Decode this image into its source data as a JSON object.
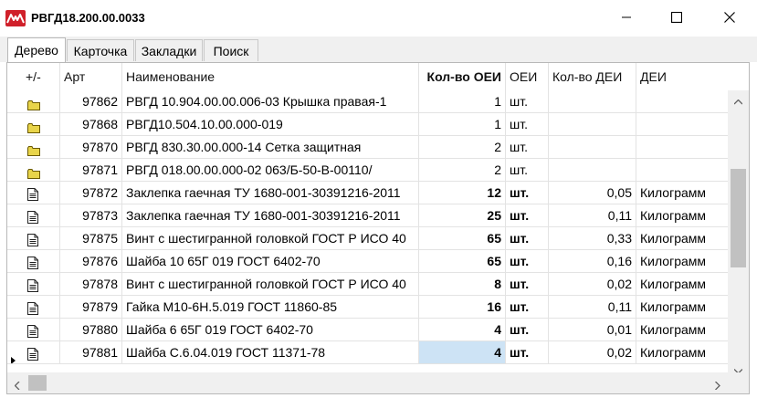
{
  "window": {
    "title": "РВГД18.200.00.0033",
    "minimize_icon": "minimize-icon",
    "maximize_icon": "maximize-icon",
    "close_icon": "close-icon"
  },
  "tabs": [
    {
      "label": "Дерево",
      "active": true
    },
    {
      "label": "Карточка",
      "active": false
    },
    {
      "label": "Закладки",
      "active": false
    },
    {
      "label": "Поиск",
      "active": false
    }
  ],
  "grid": {
    "columns": {
      "expand": "+/-",
      "art": "Арт",
      "name": "Наименование",
      "qty_oei": "Кол-во ОЕИ",
      "oei": "ОЕИ",
      "qty_dei": "Кол-во ДЕИ",
      "dei": "ДЕИ"
    },
    "rows": [
      {
        "icon": "folder-icon",
        "art": "97862",
        "name": "РВГД 10.904.00.00.006-03 Крышка правая-1",
        "qty_oei": "1",
        "oei": "шт.",
        "qty_dei": "",
        "dei": "",
        "bold": false
      },
      {
        "icon": "folder-icon",
        "art": "97868",
        "name": "РВГД10.504.10.00.000-019",
        "qty_oei": "1",
        "oei": "шт.",
        "qty_dei": "",
        "dei": "",
        "bold": false
      },
      {
        "icon": "folder-icon",
        "art": "97870",
        "name": "РВГД 830.30.00.000-14 Сетка защитная",
        "qty_oei": "2",
        "oei": "шт.",
        "qty_dei": "",
        "dei": "",
        "bold": false
      },
      {
        "icon": "folder-icon",
        "art": "97871",
        "name": "РВГД 018.00.00.000-02 063/Б-50-В-00110/",
        "qty_oei": "2",
        "oei": "шт.",
        "qty_dei": "",
        "dei": "",
        "bold": false
      },
      {
        "icon": "document-icon",
        "art": "97872",
        "name": "Заклепка гаечная ТУ 1680-001-30391216-2011",
        "qty_oei": "12",
        "oei": "шт.",
        "qty_dei": "0,05",
        "dei": "Килограмм",
        "bold": true
      },
      {
        "icon": "document-icon",
        "art": "97873",
        "name": "Заклепка гаечная ТУ 1680-001-30391216-2011",
        "qty_oei": "25",
        "oei": "шт.",
        "qty_dei": "0,11",
        "dei": "Килограмм",
        "bold": true
      },
      {
        "icon": "document-icon",
        "art": "97875",
        "name": "Винт с шестигранной головкой ГОСТ Р ИСО 40",
        "qty_oei": "65",
        "oei": "шт.",
        "qty_dei": "0,33",
        "dei": "Килограмм",
        "bold": true
      },
      {
        "icon": "document-icon",
        "art": "97876",
        "name": "Шайба 10 65Г 019 ГОСТ 6402-70",
        "qty_oei": "65",
        "oei": "шт.",
        "qty_dei": "0,16",
        "dei": "Килограмм",
        "bold": true
      },
      {
        "icon": "document-icon",
        "art": "97878",
        "name": "Винт с шестигранной головкой ГОСТ Р ИСО 40",
        "qty_oei": "8",
        "oei": "шт.",
        "qty_dei": "0,02",
        "dei": "Килограмм",
        "bold": true
      },
      {
        "icon": "document-icon",
        "art": "97879",
        "name": "Гайка М10-6Н.5.019 ГОСТ 11860-85",
        "qty_oei": "16",
        "oei": "шт.",
        "qty_dei": "0,11",
        "dei": "Килограмм",
        "bold": true
      },
      {
        "icon": "document-icon",
        "art": "97880",
        "name": "Шайба 6 65Г 019 ГОСТ 6402-70",
        "qty_oei": "4",
        "oei": "шт.",
        "qty_dei": "0,01",
        "dei": "Килограмм",
        "bold": true
      },
      {
        "icon": "document-icon",
        "art": "97881",
        "name": "Шайба С.6.04.019 ГОСТ 11371-78",
        "qty_oei": "4",
        "oei": "шт.",
        "qty_dei": "0,02",
        "dei": "Килограмм",
        "bold": true,
        "current": true
      }
    ]
  },
  "colors": {
    "app_icon": "#d0202a",
    "selection": "#cde3f5",
    "folder": "#e8d44a"
  }
}
